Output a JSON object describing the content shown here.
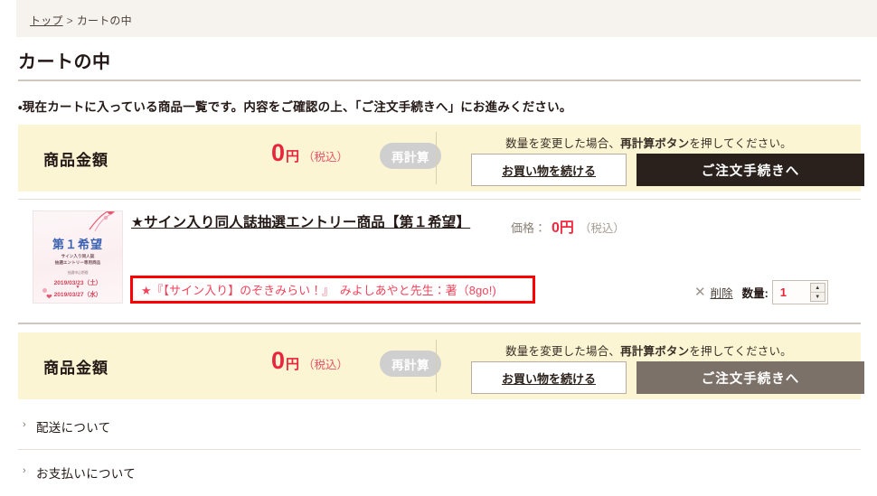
{
  "breadcrumb": {
    "home_label": "トップ",
    "separator": ">",
    "current_label": "カートの中"
  },
  "page_title": "カートの中",
  "lead_text": "・現在カートに入っている商品一覧です。内容をご確認の上、「ご注文手続きへ」にお進みください。",
  "summary_top": {
    "amount_label": "商品金額",
    "amount_number": "0",
    "amount_yen": "円",
    "amount_tax": "（税込）",
    "recalc_label": "再計算",
    "note_prefix": "数量を変更した場合、",
    "note_bold": "再計算ボタン",
    "note_suffix": "を押してください。",
    "continue_label": "お買い物を続ける",
    "checkout_label": "ご注文手続きへ"
  },
  "summary_bottom": {
    "amount_label": "商品金額",
    "amount_number": "0",
    "amount_yen": "円",
    "amount_tax": "（税込）",
    "recalc_label": "再計算",
    "note_prefix": "数量を変更した場合、",
    "note_bold": "再計算ボタン",
    "note_suffix": "を押してください。",
    "continue_label": "お買い物を続ける",
    "checkout_label": "ご注文手続きへ"
  },
  "product": {
    "title": "★サイン入り同人誌抽選エントリー商品【第１希望】",
    "price_label": "価格：",
    "price_value": "0円",
    "price_tax": "（税込）",
    "variant_text": "★『【サイン入り】のぞきみらい！』　みよしあやと先生：著（8go!)",
    "delete_label": "削除",
    "quantity_label": "数量:",
    "quantity_value": "1",
    "thumbnail": {
      "rank_text": "第１希望",
      "sub_line1": "サイン入り同人誌",
      "sub_line2": "抽選エントリー専用商品",
      "period_label": "抽選申込期間",
      "date_start": "2019/03/23（土）",
      "arrow": "▼",
      "date_end": "2019/03/27（水）"
    }
  },
  "accordion": [
    {
      "label": "配送について"
    },
    {
      "label": "お支払いについて"
    }
  ],
  "colors": {
    "summary_bg": "#fcf5d3",
    "checkout_dark": "#2a211d",
    "checkout_hover": "#7c7168",
    "price_red": "#e8253c",
    "variant_border": "#ff0000"
  }
}
